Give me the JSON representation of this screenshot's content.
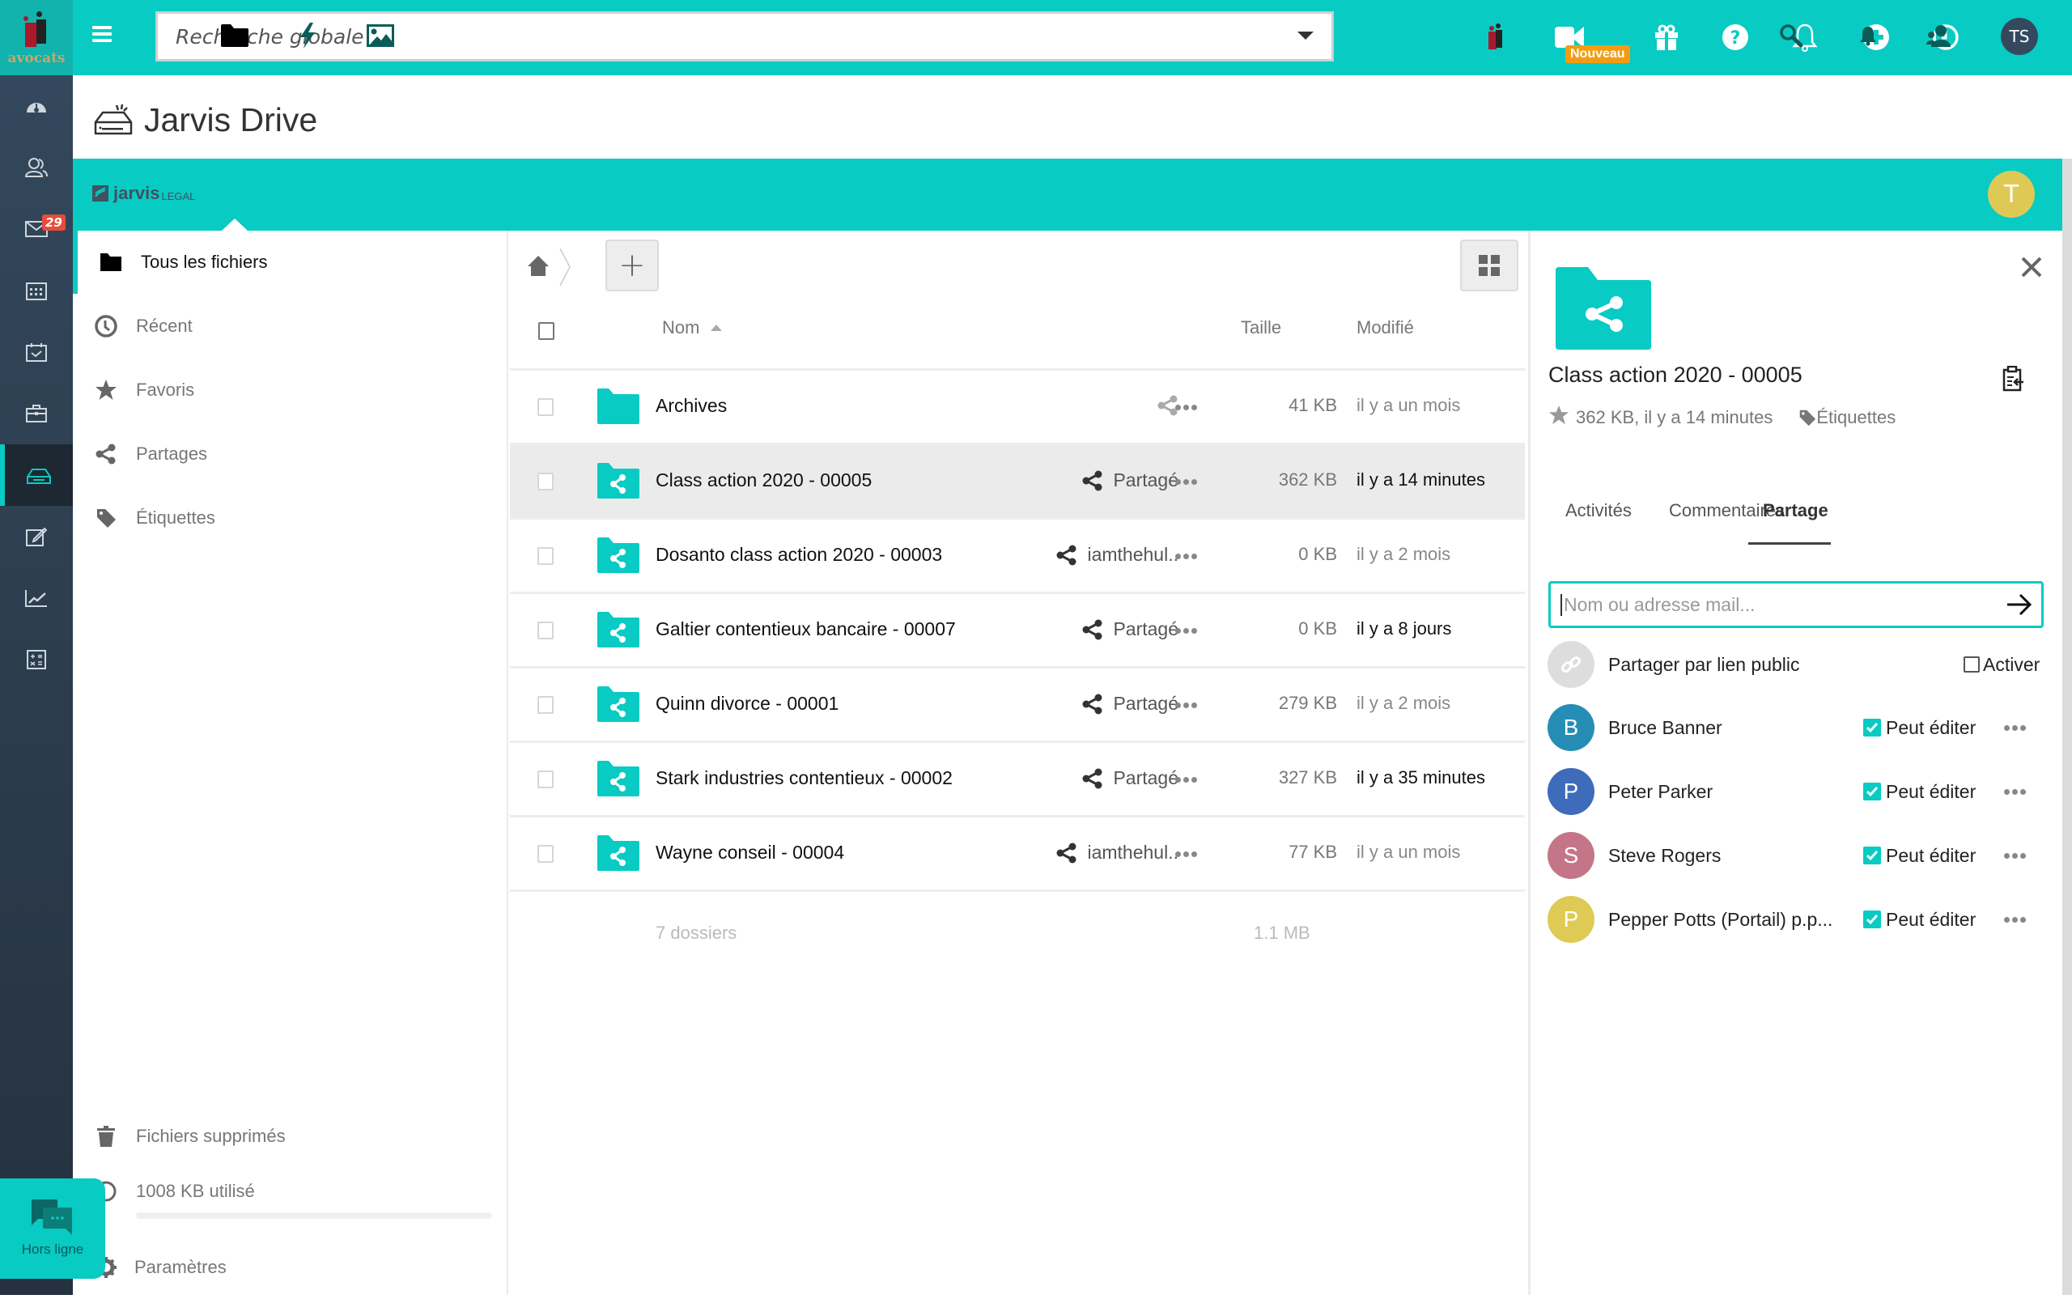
{
  "topbar": {
    "logo_text": "avocats",
    "search_placeholder": "Recherche globale",
    "new_badge": "Nouveau",
    "user_initials": "TS",
    "icons": [
      "law-firm-icon",
      "video-icon",
      "gift-icon",
      "help-icon",
      "bell-icon",
      "plus-circle-icon",
      "clock-icon"
    ]
  },
  "rail": {
    "items": [
      {
        "name": "dashboard",
        "icon": "gauge-icon"
      },
      {
        "name": "contacts",
        "icon": "users-icon"
      },
      {
        "name": "mail",
        "icon": "mail-icon",
        "badge": "29"
      },
      {
        "name": "calendar",
        "icon": "calendar-icon"
      },
      {
        "name": "tasks",
        "icon": "calendar-check-icon"
      },
      {
        "name": "cases",
        "icon": "briefcase-icon"
      },
      {
        "name": "drive",
        "icon": "drive-icon",
        "active": true
      },
      {
        "name": "notes",
        "icon": "edit-icon"
      },
      {
        "name": "reports",
        "icon": "chart-icon"
      },
      {
        "name": "billing",
        "icon": "calculator-icon"
      }
    ]
  },
  "page": {
    "title": "Jarvis Drive"
  },
  "subbar": {
    "brand": "jarvis",
    "brand_suffix": "LEGAL",
    "user_initial": "T"
  },
  "leftnav": {
    "items": [
      {
        "label": "Tous les fichiers",
        "icon": "folder-icon",
        "active": true
      },
      {
        "label": "Récent",
        "icon": "clock-icon"
      },
      {
        "label": "Favoris",
        "icon": "star-icon"
      },
      {
        "label": "Partages",
        "icon": "share-icon"
      },
      {
        "label": "Étiquettes",
        "icon": "tag-icon"
      }
    ],
    "trash_label": "Fichiers supprimés",
    "quota_label": "1008 KB utilisé",
    "quota_fraction": 0.0,
    "settings_label": "Paramètres"
  },
  "chat": {
    "label": "Hors ligne"
  },
  "filelist": {
    "headers": {
      "name": "Nom",
      "size": "Taille",
      "modified": "Modifié"
    },
    "rows": [
      {
        "name": "Archives",
        "shared": false,
        "share_label": "",
        "size": "41 KB",
        "modified": "il y a un mois",
        "recent": false,
        "selected": false
      },
      {
        "name": "Class action 2020 - 00005",
        "shared": true,
        "share_label": "Partagé",
        "size": "362 KB",
        "modified": "il y a 14 minutes",
        "recent": true,
        "selected": true
      },
      {
        "name": "Dosanto class action 2020 - 00003",
        "shared": true,
        "share_label": "iamthehul..",
        "size": "0 KB",
        "modified": "il y a 2 mois",
        "recent": false,
        "selected": false
      },
      {
        "name": "Galtier contentieux bancaire - 00007",
        "shared": true,
        "share_label": "Partagé",
        "size": "0 KB",
        "modified": "il y a 8 jours",
        "recent": true,
        "selected": false
      },
      {
        "name": "Quinn divorce - 00001",
        "shared": true,
        "share_label": "Partagé",
        "size": "279 KB",
        "modified": "il y a 2 mois",
        "recent": false,
        "selected": false
      },
      {
        "name": "Stark industries contentieux - 00002",
        "shared": true,
        "share_label": "Partagé",
        "size": "327 KB",
        "modified": "il y a 35 minutes",
        "recent": true,
        "selected": false
      },
      {
        "name": "Wayne conseil - 00004",
        "shared": true,
        "share_label": "iamthehul..",
        "size": "77 KB",
        "modified": "il y a un mois",
        "recent": false,
        "selected": false
      }
    ],
    "summary_count": "7 dossiers",
    "summary_size": "1.1 MB"
  },
  "details": {
    "title": "Class action 2020 - 00005",
    "meta": "362 KB, il y a 14 minutes",
    "tags_label": "Étiquettes",
    "tabs": [
      {
        "label": "Activités",
        "active": false
      },
      {
        "label": "Commentaires",
        "active": false
      },
      {
        "label": "Partage",
        "active": true
      }
    ],
    "share_input_placeholder": "Nom ou adresse mail...",
    "public_link_label": "Partager par lien public",
    "public_link_toggle": "Activer",
    "shares": [
      {
        "initial": "B",
        "name": "Bruce Banner",
        "color": "#268eb5",
        "permission": "Peut éditer",
        "checked": true
      },
      {
        "initial": "P",
        "name": "Peter Parker",
        "color": "#3e6cba",
        "permission": "Peut éditer",
        "checked": true
      },
      {
        "initial": "S",
        "name": "Steve Rogers",
        "color": "#c57588",
        "permission": "Peut éditer",
        "checked": true
      },
      {
        "initial": "P",
        "name": "Pepper Potts (Portail) p.p...",
        "color": "#dfca55",
        "permission": "Peut éditer",
        "checked": true
      }
    ]
  },
  "colors": {
    "accent": "#08cbc3",
    "rail": "#2c3e50",
    "badge": "#e74c3c",
    "new_badge": "#f39c12"
  }
}
